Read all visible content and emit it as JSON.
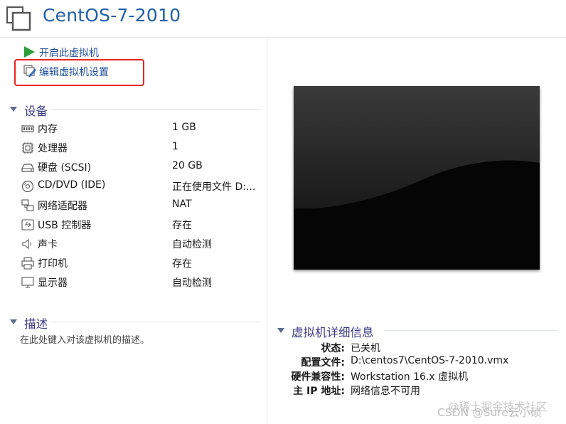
{
  "header": {
    "title": "CentOS-7-2010",
    "icon": "vm-window-icon"
  },
  "commands": [
    {
      "label": "开启此虚拟机",
      "icon": "play-icon"
    },
    {
      "label": "编辑虚拟机设置",
      "icon": "edit-settings-icon"
    }
  ],
  "devices": {
    "title": "设备",
    "items": [
      {
        "name": "内存",
        "value": "1 GB",
        "icon": "memory-icon"
      },
      {
        "name": "处理器",
        "value": "1",
        "icon": "processor-icon"
      },
      {
        "name": "硬盘 (SCSI)",
        "value": "20 GB",
        "icon": "hard-disk-icon"
      },
      {
        "name": "CD/DVD (IDE)",
        "value": "正在使用文件 D:...",
        "icon": "cd-dvd-icon"
      },
      {
        "name": "网络适配器",
        "value": "NAT",
        "icon": "network-adapter-icon"
      },
      {
        "name": "USB 控制器",
        "value": "存在",
        "icon": "usb-icon"
      },
      {
        "name": "声卡",
        "value": "自动检测",
        "icon": "speaker-icon"
      },
      {
        "name": "打印机",
        "value": "存在",
        "icon": "printer-icon"
      },
      {
        "name": "显示器",
        "value": "自动检测",
        "icon": "monitor-icon"
      }
    ]
  },
  "description": {
    "title": "描述",
    "placeholder": "在此处键入对该虚拟机的描述。"
  },
  "details": {
    "title": "虚拟机详细信息",
    "rows": [
      {
        "key": "状态:",
        "value": "已关机"
      },
      {
        "key": "配置文件:",
        "value": "D:\\centos7\\CentOS-7-2010.vmx"
      },
      {
        "key": "硬件兼容性:",
        "value": "Workstation 16.x 虚拟机"
      },
      {
        "key": "主 IP 地址:",
        "value": "网络信息不可用"
      }
    ]
  },
  "watermark": {
    "line1": "@稀土掘金技术社区",
    "line2": "CSDN @Sure云小硕"
  },
  "colors": {
    "title": "#1f5fa8",
    "link": "#1f4e9c",
    "section": "#3b3a8a",
    "highlight": "#e8231d",
    "play": "#2e9e3a"
  }
}
